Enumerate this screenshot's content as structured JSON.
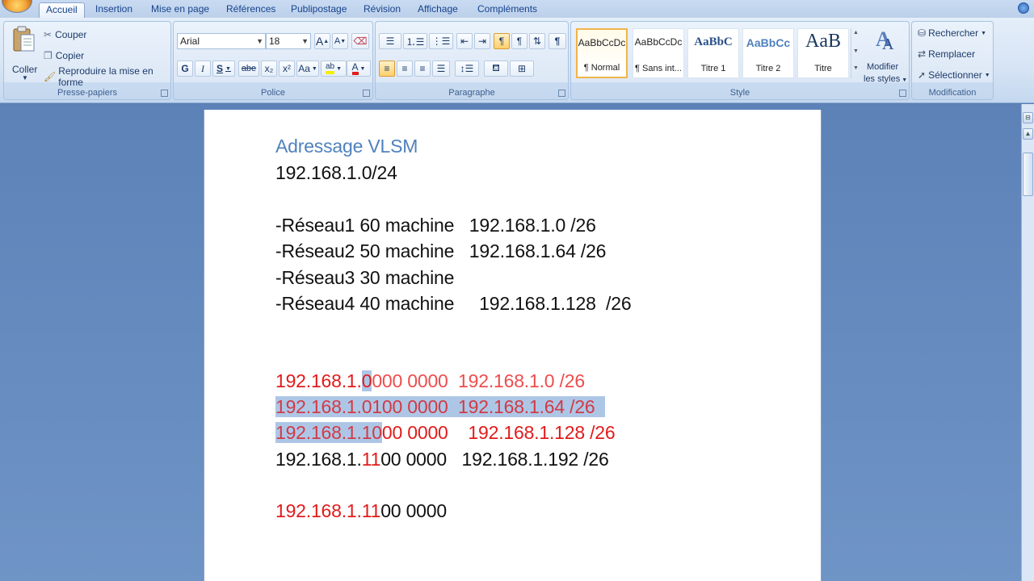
{
  "tabs": [
    "Accueil",
    "Insertion",
    "Mise en page",
    "Références",
    "Publipostage",
    "Révision",
    "Affichage",
    "Compléments"
  ],
  "ribbon": {
    "clipboard": {
      "label": "Presse-papiers",
      "paste": "Coller",
      "cut": "Couper",
      "copy": "Copier",
      "format_painter": "Reproduire la mise en forme"
    },
    "font": {
      "label": "Police",
      "font_name": "Arial",
      "font_size": "18",
      "grow": "A",
      "shrink": "A",
      "bold": "G",
      "italic": "I",
      "underline": "S",
      "strike": "abe",
      "subscript": "x₂",
      "superscript": "x²",
      "case": "Aa",
      "highlight": "ab",
      "color": "A"
    },
    "paragraph": {
      "label": "Paragraphe"
    },
    "styles": {
      "label": "Style",
      "items": [
        {
          "sample": "AaBbCcDc",
          "name": "¶ Normal"
        },
        {
          "sample": "AaBbCcDc",
          "name": "¶ Sans int..."
        },
        {
          "sample": "AaBbC",
          "name": "Titre 1"
        },
        {
          "sample": "AaBbCc",
          "name": "Titre 2"
        },
        {
          "sample": "AaB",
          "name": "Titre"
        }
      ],
      "modify_line1": "Modifier",
      "modify_line2": "les styles"
    },
    "editing": {
      "label": "Modification",
      "find": "Rechercher",
      "replace": "Remplacer",
      "select": "Sélectionner"
    }
  },
  "document": {
    "title": "Adressage VLSM",
    "network": "192.168.1.0/24",
    "reseaux": [
      {
        "text": "-Réseau1 60 machine   192.168.1.0 /26"
      },
      {
        "text": "-Réseau2 50 machine   192.168.1.64 /26"
      },
      {
        "text": "-Réseau3 30 machine"
      },
      {
        "text": "-Réseau4 40 machine     192.168.1.128  /26"
      }
    ],
    "binary_lines": [
      {
        "prefix": "192.168.1.",
        "bits": "0",
        "rest": "000 0000",
        "gap": "  ",
        "addr": "192.168.1.0 /26"
      },
      {
        "prefix": "192.168.1.",
        "bits": "01",
        "rest": "00 0000",
        "gap": "  ",
        "addr": "192.168.1.64 /26"
      },
      {
        "prefix": "192.168.1.",
        "bits": "10",
        "rest": "00 0000",
        "gap": "    ",
        "addr": "192.168.1.128 /26"
      },
      {
        "prefix": "192.168.1.",
        "bits": "11",
        "rest": "00 0000",
        "gap": "   ",
        "addr": "192.168.1.192 /26"
      }
    ],
    "last_line": {
      "prefix": "192.168.1.",
      "bits": "11",
      "rest": "00 0000"
    }
  },
  "colors": {
    "title_blue": "#4f81bd",
    "red": "#e21b1b",
    "selection": "#aec6e6",
    "ribbon_bg": "#dbe7f6"
  }
}
